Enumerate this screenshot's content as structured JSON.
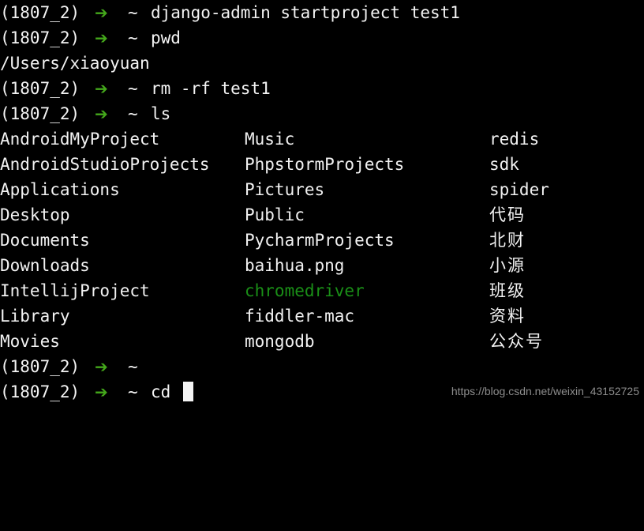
{
  "terminal": {
    "background_color": "#000000",
    "foreground_color": "#f2f2f2",
    "prompt_arrow_color": "#44a81b",
    "executable_color": "#1a8f17",
    "prompt": {
      "venv": "(1807_2)",
      "arrow_icon": "right-arrow-icon",
      "arrow_glyph": "➔",
      "path": "~"
    },
    "lines": [
      {
        "type": "prompt",
        "command": "django-admin startproject test1"
      },
      {
        "type": "prompt",
        "command": "pwd"
      },
      {
        "type": "output",
        "text": "/Users/xiaoyuan"
      },
      {
        "type": "prompt",
        "command": "rm -rf test1"
      },
      {
        "type": "prompt",
        "command": "ls"
      }
    ],
    "ls_output": {
      "rows": [
        {
          "c1": "AndroidMyProject",
          "c2": "Music",
          "c3": "redis"
        },
        {
          "c1": "AndroidStudioProjects",
          "c2": "PhpstormProjects",
          "c3": "sdk"
        },
        {
          "c1": "Applications",
          "c2": "Pictures",
          "c3": "spider"
        },
        {
          "c1": "Desktop",
          "c2": "Public",
          "c3": "代码"
        },
        {
          "c1": "Documents",
          "c2": "PycharmProjects",
          "c3": "北财"
        },
        {
          "c1": "Downloads",
          "c2": "baihua.png",
          "c3": "小源"
        },
        {
          "c1": "IntellijProject",
          "c2": "chromedriver",
          "c3": "班级"
        },
        {
          "c1": "Library",
          "c2": "fiddler-mac",
          "c3": "资料"
        },
        {
          "c1": "Movies",
          "c2": "mongodb",
          "c3": "公众号"
        }
      ]
    },
    "trailing_lines": [
      {
        "type": "prompt",
        "command": ""
      },
      {
        "type": "prompt",
        "command": "cd ",
        "cursor": true
      }
    ]
  },
  "watermark": {
    "text": "https://blog.csdn.net/weixin_43152725",
    "color": "#8d8d8d"
  }
}
